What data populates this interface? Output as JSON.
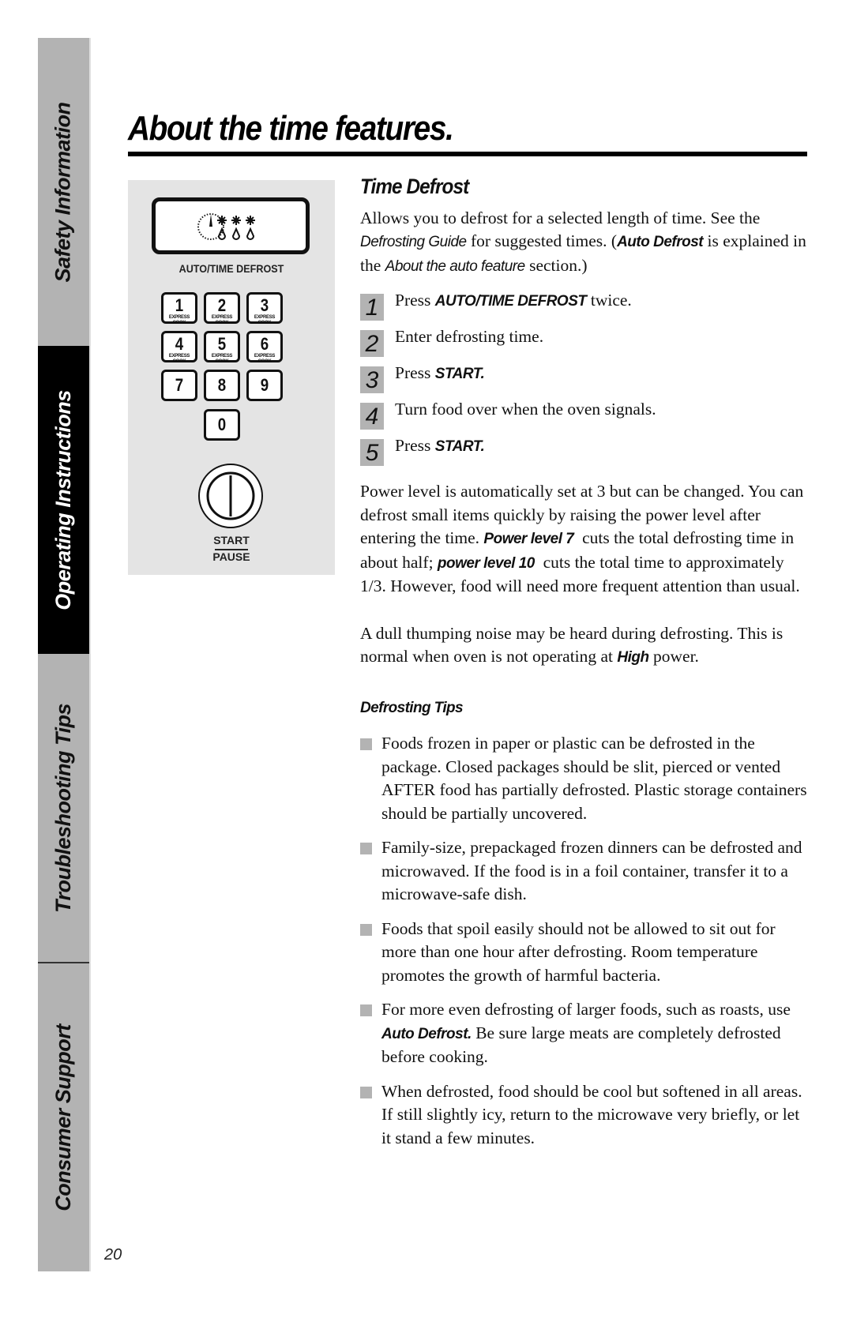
{
  "side_tabs": [
    {
      "label": "Safety Information",
      "active": false
    },
    {
      "label": "Operating Instructions",
      "active": true
    },
    {
      "label": "Troubleshooting Tips",
      "active": false
    },
    {
      "label": "Consumer Support",
      "active": false
    }
  ],
  "page_number": "20",
  "title": "About the time features.",
  "panel": {
    "display_icon": "defrost-display-icon",
    "defrost_label": "AUTO/TIME DEFROST",
    "keys": [
      {
        "num": "1",
        "sub": "EXPRESS COOK"
      },
      {
        "num": "2",
        "sub": "EXPRESS COOK"
      },
      {
        "num": "3",
        "sub": "EXPRESS COOK"
      },
      {
        "num": "4",
        "sub": "EXPRESS COOK"
      },
      {
        "num": "5",
        "sub": "EXPRESS COOK"
      },
      {
        "num": "6",
        "sub": "EXPRESS COOK"
      },
      {
        "num": "7",
        "sub": ""
      },
      {
        "num": "8",
        "sub": ""
      },
      {
        "num": "9",
        "sub": ""
      },
      {
        "num": "0",
        "sub": ""
      }
    ],
    "start_label": "START",
    "pause_label": "PAUSE"
  },
  "section": {
    "heading": "Time Defrost",
    "intro": {
      "t1": "Allows you to defrost for a selected length of time. See the ",
      "guide": "Defrosting Guide",
      "t2": " for suggested times. (",
      "auto_defrost": "Auto Defrost",
      "t3": " is explained in the ",
      "about_auto": "About the auto feature",
      "t4": " section.)"
    },
    "steps": [
      {
        "n": "1",
        "pre": "Press ",
        "bold": "AUTO/TIME DEFROST",
        "post": " twice."
      },
      {
        "n": "2",
        "pre": "Enter defrosting time.",
        "bold": "",
        "post": ""
      },
      {
        "n": "3",
        "pre": "Press ",
        "bold": "START.",
        "post": ""
      },
      {
        "n": "4",
        "pre": "Turn food over when the oven signals.",
        "bold": "",
        "post": ""
      },
      {
        "n": "5",
        "pre": "Press ",
        "bold": "START.",
        "post": ""
      }
    ],
    "power": {
      "t1": "Power level is automatically set at 3 but can be changed. You can defrost small items quickly by raising the power level after entering the time. ",
      "pl7": "Power level 7",
      "t2": "  cuts the total defrosting time in about half; ",
      "pl10": "power level 10",
      "t3": "  cuts the total time to approximately 1/3. However, food will need more frequent attention than usual."
    },
    "noise": {
      "t1": "A dull thumping noise may be heard during defrosting. This is normal when oven is not operating at ",
      "high": "High",
      "t2": " power."
    },
    "tips_heading": "Defrosting Tips",
    "tips": [
      {
        "pre": "Foods frozen in paper or plastic can be defrosted in the package. Closed packages should be slit, pierced or vented AFTER food has partially defrosted. Plastic storage containers should be partially uncovered.",
        "bold": "",
        "post": ""
      },
      {
        "pre": "Family-size, prepackaged frozen dinners can be defrosted and microwaved. If the food is in a foil container, transfer it to a microwave-safe dish.",
        "bold": "",
        "post": ""
      },
      {
        "pre": "Foods that spoil easily should not be allowed to sit out for more than one hour after defrosting. Room temperature promotes the growth of harmful bacteria.",
        "bold": "",
        "post": ""
      },
      {
        "pre": "For more even defrosting of larger foods, such as roasts, use ",
        "bold": "Auto Defrost.",
        "post": " Be sure large meats are completely defrosted before cooking."
      },
      {
        "pre": "When defrosted, food should be cool but softened in all areas. If still slightly icy, return to the microwave very briefly, or let it stand a few minutes.",
        "bold": "",
        "post": ""
      }
    ]
  }
}
